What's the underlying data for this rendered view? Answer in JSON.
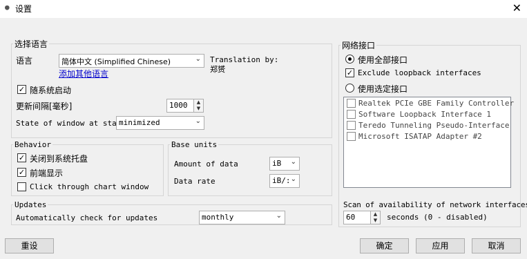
{
  "window": {
    "title": "设置"
  },
  "language_group": {
    "title": "选择语言",
    "language_label": "语言",
    "language_value": "简体中文 (Simplified Chinese)",
    "translation_by_label": "Translation by:",
    "translator": "郑赟",
    "add_language_link": "添加其他语言",
    "autostart_label": "随系统启动",
    "autostart_checked": true,
    "update_interval_label": "更新间隔[毫秒]",
    "update_interval_value": "1000",
    "window_state_label": "State of window at start",
    "window_state_value": "minimized"
  },
  "behavior_group": {
    "title": "Behavior",
    "close_to_tray_label": "关闭到系统托盘",
    "close_to_tray_checked": true,
    "always_on_top_label": "前端显示",
    "always_on_top_checked": true,
    "click_through_label": "Click through chart window",
    "click_through_checked": false
  },
  "base_units_group": {
    "title": "Base units",
    "amount_label": "Amount of data",
    "amount_value": "iB",
    "rate_label": "Data rate",
    "rate_value": "iB/:"
  },
  "updates_group": {
    "title": "Updates",
    "auto_check_label": "Automatically check for updates",
    "auto_check_value": "monthly"
  },
  "network_group": {
    "title": "网络接口",
    "use_all_label": "使用全部接口",
    "use_all_selected": true,
    "exclude_loopback_label": "Exclude loopback interfaces",
    "exclude_loopback_checked": true,
    "use_selected_label": "使用选定接口",
    "use_selected_selected": false,
    "interfaces": [
      "Realtek PCIe GBE Family Controller",
      "Software Loopback Interface 1",
      "Teredo Tunneling Pseudo-Interface",
      "Microsoft ISATAP Adapter #2"
    ],
    "scan_label": "Scan of availability of network interfaces",
    "scan_value": "60",
    "scan_suffix": "seconds (0 - disabled)"
  },
  "buttons": {
    "reset": "重设",
    "ok": "确定",
    "apply": "应用",
    "cancel": "取消"
  },
  "icons": {
    "app": "app-icon",
    "close": "close-icon"
  }
}
